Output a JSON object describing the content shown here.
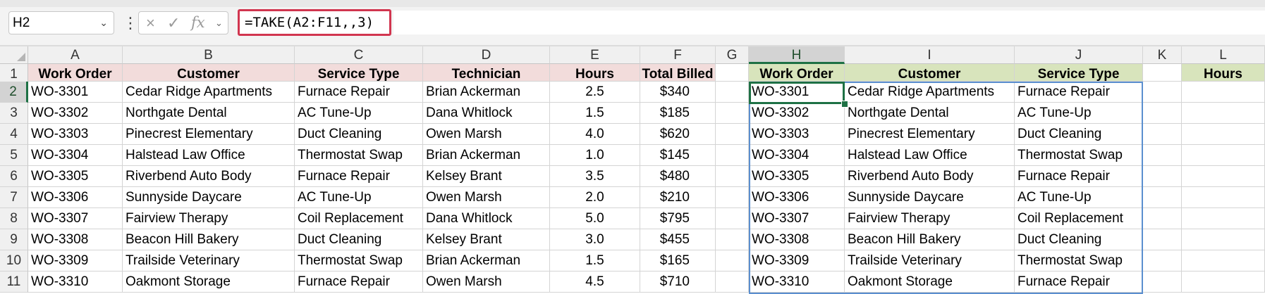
{
  "name_box": {
    "value": "H2"
  },
  "formula_bar": {
    "formula": "=TAKE(A2:F11,,3)"
  },
  "icons": {
    "cancel": "×",
    "enter": "✓",
    "fx": "fx",
    "dropdown": "⌄",
    "more": "⋮",
    "chevron": "⌄"
  },
  "columns": [
    "A",
    "B",
    "C",
    "D",
    "E",
    "F",
    "G",
    "H",
    "I",
    "J",
    "K",
    "L"
  ],
  "selected_column": "H",
  "selected_row": 2,
  "rows": [
    "1",
    "2",
    "3",
    "4",
    "5",
    "6",
    "7",
    "8",
    "9",
    "10",
    "11"
  ],
  "headers": {
    "A": "Work Order",
    "B": "Customer",
    "C": "Service Type",
    "D": "Technician",
    "E": "Hours",
    "F": "Total Billed",
    "H": "Work Order",
    "I": "Customer",
    "J": "Service Type",
    "L": "Hours"
  },
  "source_table": [
    [
      "WO-3301",
      "Cedar Ridge Apartments",
      "Furnace Repair",
      "Brian Ackerman",
      "2.5",
      "$340"
    ],
    [
      "WO-3302",
      "Northgate Dental",
      "AC Tune-Up",
      "Dana Whitlock",
      "1.5",
      "$185"
    ],
    [
      "WO-3303",
      "Pinecrest Elementary",
      "Duct Cleaning",
      "Owen Marsh",
      "4.0",
      "$620"
    ],
    [
      "WO-3304",
      "Halstead Law Office",
      "Thermostat Swap",
      "Brian Ackerman",
      "1.0",
      "$145"
    ],
    [
      "WO-3305",
      "Riverbend Auto Body",
      "Furnace Repair",
      "Kelsey Brant",
      "3.5",
      "$480"
    ],
    [
      "WO-3306",
      "Sunnyside Daycare",
      "AC Tune-Up",
      "Owen Marsh",
      "2.0",
      "$210"
    ],
    [
      "WO-3307",
      "Fairview Therapy",
      "Coil Replacement",
      "Dana Whitlock",
      "5.0",
      "$795"
    ],
    [
      "WO-3308",
      "Beacon Hill Bakery",
      "Duct Cleaning",
      "Kelsey Brant",
      "3.0",
      "$455"
    ],
    [
      "WO-3309",
      "Trailside Veterinary",
      "Thermostat Swap",
      "Brian Ackerman",
      "1.5",
      "$165"
    ],
    [
      "WO-3310",
      "Oakmont Storage",
      "Furnace Repair",
      "Owen Marsh",
      "4.5",
      "$710"
    ]
  ],
  "result_table": [
    [
      "WO-3301",
      "Cedar Ridge Apartments",
      "Furnace Repair"
    ],
    [
      "WO-3302",
      "Northgate Dental",
      "AC Tune-Up"
    ],
    [
      "WO-3303",
      "Pinecrest Elementary",
      "Duct Cleaning"
    ],
    [
      "WO-3304",
      "Halstead Law Office",
      "Thermostat Swap"
    ],
    [
      "WO-3305",
      "Riverbend Auto Body",
      "Furnace Repair"
    ],
    [
      "WO-3306",
      "Sunnyside Daycare",
      "AC Tune-Up"
    ],
    [
      "WO-3307",
      "Fairview Therapy",
      "Coil Replacement"
    ],
    [
      "WO-3308",
      "Beacon Hill Bakery",
      "Duct Cleaning"
    ],
    [
      "WO-3309",
      "Trailside Veterinary",
      "Thermostat Swap"
    ],
    [
      "WO-3310",
      "Oakmont Storage",
      "Furnace Repair"
    ]
  ],
  "colors": {
    "source_header_fill": "#f2dcdb",
    "result_header_fill": "#d8e4bc",
    "formula_highlight": "#d1354f",
    "selection": "#1e7145",
    "spill_border": "#5b8fcf"
  }
}
